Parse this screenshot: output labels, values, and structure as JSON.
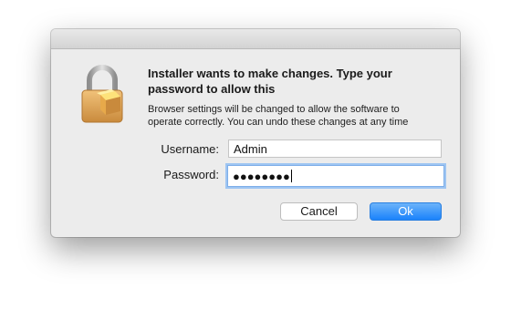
{
  "dialog": {
    "headline": "Installer wants to make changes. Type your\npassword to allow this",
    "message": "Browser settings will be changed to allow the software to\noperate correctly. You can undo these changes at any time",
    "icon": "lock-icon"
  },
  "form": {
    "username_label": "Username:",
    "username_value": "Admin",
    "password_label": "Password:",
    "password_masked": "●●●●●●●●"
  },
  "buttons": {
    "cancel_label": "Cancel",
    "ok_label": "Ok"
  },
  "colors": {
    "dialog_bg": "#ececec",
    "primary_button": "#1a82fb",
    "focus_ring": "#9ec5f2"
  }
}
